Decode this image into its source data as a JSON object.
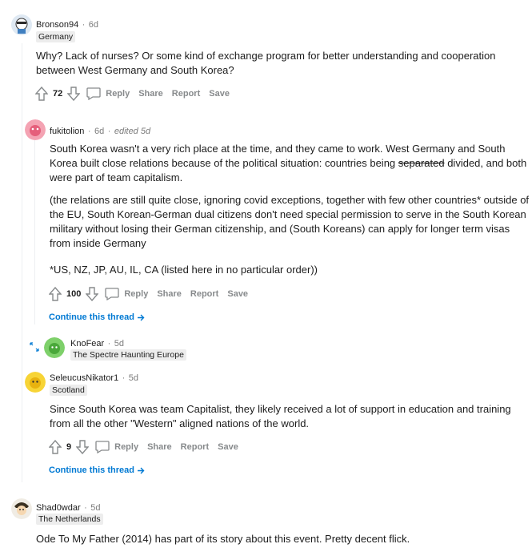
{
  "comments": [
    {
      "username": "Bronson94",
      "time": "6d",
      "flair": "Germany",
      "body": [
        "Why? Lack of nurses? Or some kind of exchange program for better understanding and cooperation between West Germany and South Korea?"
      ],
      "score": "72",
      "actions": {
        "reply": "Reply",
        "share": "Share",
        "report": "Report",
        "save": "Save"
      }
    },
    {
      "username": "fukitolion",
      "time": "6d",
      "edited": "edited 5d",
      "body_p1_a": "South Korea wasn't a very rich place at the time, and they came to work. West Germany and South Korea built close relations because of the political situation: countries being ",
      "body_p1_strike": "separated",
      "body_p1_b": " divided, and both were part of team capitalism.",
      "body_p2": "(the relations are still quite close, ignoring covid exceptions, together with few other countries* outside of the EU, South Korean-German dual citizens don't need special permission to serve in the South Korean military without losing their German citizenship, and (South Koreans) can apply for longer term visas from inside Germany",
      "body_p3": "*US, NZ, JP, AU, IL, CA (listed here in no particular order))",
      "score": "100",
      "actions": {
        "reply": "Reply",
        "share": "Share",
        "report": "Report",
        "save": "Save"
      },
      "continue": "Continue this thread"
    },
    {
      "username": "KnoFear",
      "time": "5d",
      "flair": "The Spectre Haunting Europe"
    },
    {
      "username": "SeleucusNikator1",
      "time": "5d",
      "flair": "Scotland",
      "body": "Since South Korea was team Capitalist, they likely received a lot of support in education and training from all the other \"Western\" aligned nations of the world.",
      "score": "9",
      "actions": {
        "reply": "Reply",
        "share": "Share",
        "report": "Report",
        "save": "Save"
      },
      "continue": "Continue this thread"
    },
    {
      "username": "Shad0wdar",
      "time": "5d",
      "flair": "The Netherlands",
      "body": "Ode To My Father (2014) has part of its story about this event. Pretty decent flick."
    }
  ],
  "separator": "·",
  "colors": {
    "accent_link": "#0079d3",
    "meta_gray": "#7c7c7c",
    "action_gray": "#878a8c",
    "flair_bg": "#ededed"
  },
  "icons": [
    "upvote-icon",
    "downvote-icon",
    "comment-bubble-icon",
    "arrow-right-icon",
    "expand-icon"
  ]
}
